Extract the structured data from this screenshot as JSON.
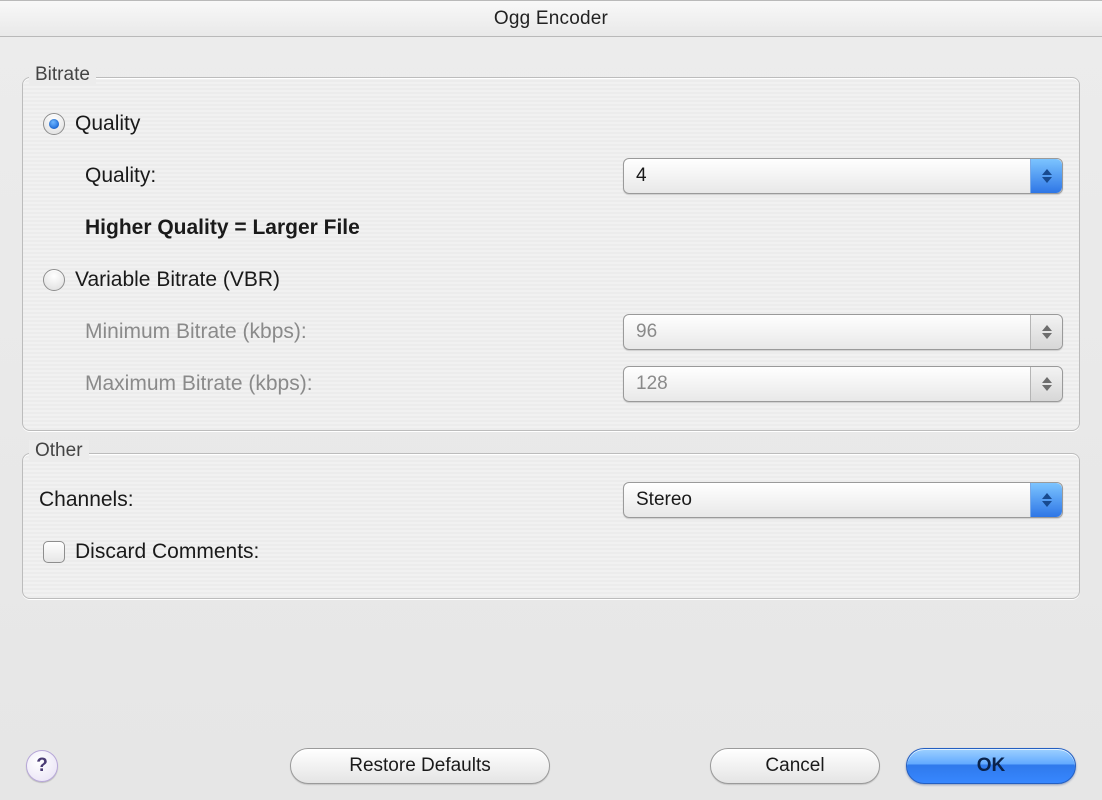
{
  "window": {
    "title": "Ogg Encoder"
  },
  "bitrate": {
    "group_label": "Bitrate",
    "modes": {
      "quality_label": "Quality",
      "vbr_label": "Variable Bitrate (VBR)",
      "mode": "quality"
    },
    "quality": {
      "field_label": "Quality:",
      "value": "4",
      "hint": "Higher Quality = Larger File"
    },
    "vbr": {
      "min_label": "Minimum Bitrate (kbps):",
      "min_value": "96",
      "max_label": "Maximum Bitrate (kbps):",
      "max_value": "128"
    }
  },
  "other": {
    "group_label": "Other",
    "channels_label": "Channels:",
    "channels_value": "Stereo",
    "discard_label": "Discard Comments:",
    "discard_checked": false
  },
  "buttons": {
    "help": "?",
    "restore": "Restore Defaults",
    "cancel": "Cancel",
    "ok": "OK"
  }
}
